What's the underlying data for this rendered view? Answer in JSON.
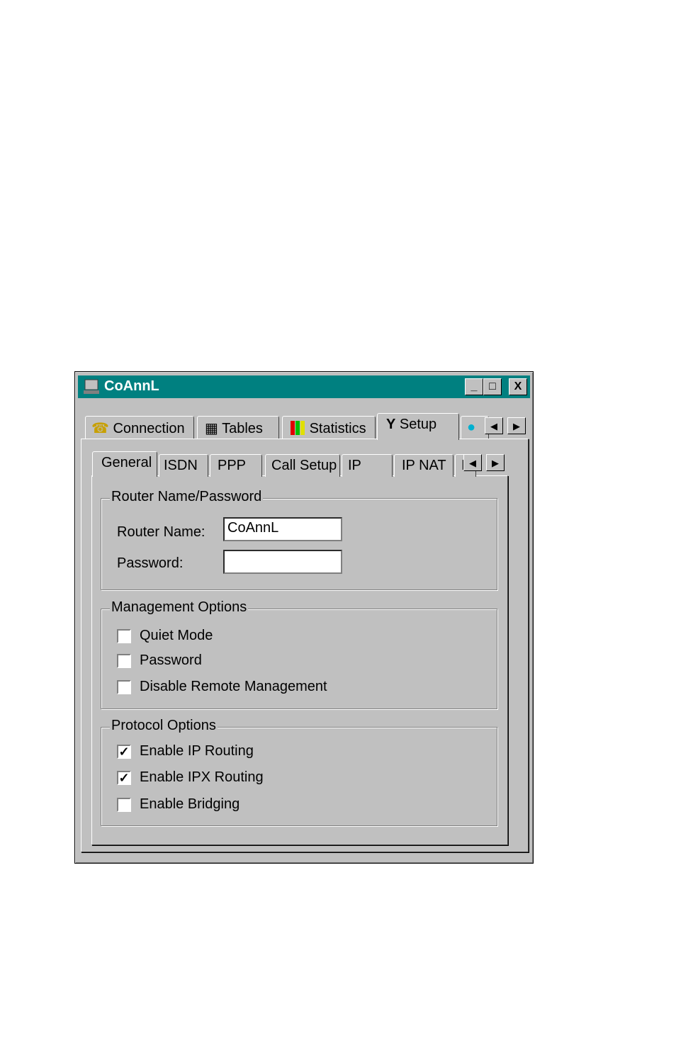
{
  "window": {
    "title": "CoAnnL",
    "minimize": "_",
    "maximize": "□",
    "close": "X"
  },
  "outer_tabs": [
    {
      "label": "Connection",
      "icon": "phone-icon"
    },
    {
      "label": "Tables",
      "icon": "table-icon"
    },
    {
      "label": "Statistics",
      "icon": "bar-chart-icon"
    },
    {
      "label": "Setup",
      "icon": "wrench-icon",
      "active": true
    },
    {
      "label": "",
      "icon": "pin-icon"
    }
  ],
  "inner_tabs": [
    {
      "label": "General",
      "active": true
    },
    {
      "label": "ISDN"
    },
    {
      "label": "PPP"
    },
    {
      "label": "Call Setup"
    },
    {
      "label": "IP"
    },
    {
      "label": "IP NAT"
    },
    {
      "label": "I"
    }
  ],
  "scroll": {
    "left": "◀",
    "right": "▶"
  },
  "router_group": {
    "title": "Router Name/Password",
    "name_label": "Router Name:",
    "name_value": "CoAnnL",
    "password_label": "Password:",
    "password_value": ""
  },
  "management_group": {
    "title": "Management Options",
    "options": [
      {
        "label": "Quiet Mode",
        "checked": false
      },
      {
        "label": "Password",
        "checked": false
      },
      {
        "label": "Disable Remote Management",
        "checked": false
      }
    ]
  },
  "protocol_group": {
    "title": "Protocol Options",
    "options": [
      {
        "label": "Enable IP Routing",
        "checked": true
      },
      {
        "label": "Enable IPX Routing",
        "checked": true
      },
      {
        "label": "Enable Bridging",
        "checked": false
      }
    ]
  },
  "colors": {
    "titlebar": "#008080",
    "face": "#c0c0c0"
  }
}
